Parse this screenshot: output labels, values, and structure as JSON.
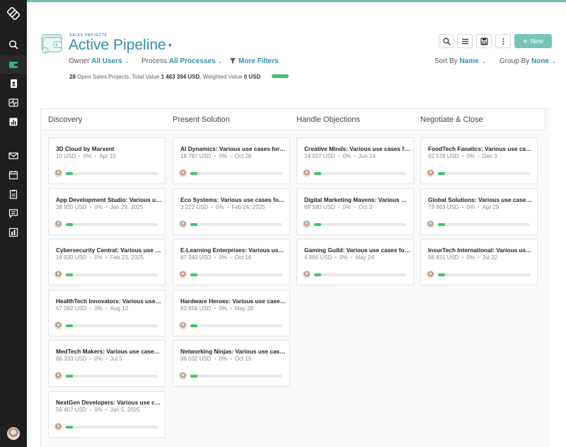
{
  "colors": {
    "accent": "#2f8fb0",
    "new_button": "#76c4b6",
    "progress": "#3cc46a",
    "sidebar": "#1f1f1f"
  },
  "sidebar": {
    "logo": "layers-logo-icon",
    "items": [
      {
        "icon": "search-icon"
      },
      {
        "icon": "wallet-icon",
        "active": true
      },
      {
        "icon": "contacts-icon"
      },
      {
        "icon": "activity-icon"
      },
      {
        "icon": "report-icon"
      },
      {
        "icon": "mail-icon"
      },
      {
        "icon": "calendar-icon"
      },
      {
        "icon": "clipboard-icon"
      },
      {
        "icon": "chat-icon"
      },
      {
        "icon": "chart-icon"
      }
    ]
  },
  "header": {
    "subtitle": "SALES PROJECTS",
    "title": "Active Pipeline",
    "owner_label": "Owner",
    "owner_value": "All Users",
    "process_label": "Process",
    "process_value": "All Processes",
    "more_filters": "More Filters",
    "summary": {
      "count": "28",
      "text1": "Open Sales Projects, Total Value",
      "total": "1 463 394 USD",
      "text2": ", Weighted Value",
      "weighted": "0 USD"
    }
  },
  "toolbar": {
    "new_label": "New",
    "sort_label": "Sort By",
    "sort_value": "Name",
    "group_label": "Group By",
    "group_value": "None"
  },
  "columns": [
    {
      "title": "Discovery",
      "cards": [
        {
          "name": "3D Cloud by Marxent",
          "value": "10 USD",
          "percent": "0%",
          "date": "Apr 10",
          "progress": 0.08
        },
        {
          "name": "App Development Studio: Various use cases for Plan",
          "value": "38 920 USD",
          "percent": "0%",
          "date": "Jan 29, 2025",
          "progress": 0.08
        },
        {
          "name": "Cybersecurity Central: Various use cases for Plan",
          "value": "16 930 USD",
          "percent": "0%",
          "date": "Feb 23, 2025",
          "progress": 0.08
        },
        {
          "name": "HealthTech Innovators: Various use cases for Plan",
          "value": "67 092 USD",
          "percent": "0%",
          "date": "Aug 12",
          "progress": 0.08
        },
        {
          "name": "MedTech Makers: Various use cases for Plan",
          "value": "66 333 USD",
          "percent": "0%",
          "date": "Jul 5",
          "progress": 0.08
        },
        {
          "name": "NextGen Developers: Various use cases for Plan",
          "value": "56 407 USD",
          "percent": "0%",
          "date": "Jan 5, 2025",
          "progress": 0.08
        }
      ]
    },
    {
      "title": "Present Solution",
      "cards": [
        {
          "name": "AI Dynamics: Various use cases for Plan",
          "value": "18 787 USD",
          "percent": "0%",
          "date": "Oct 26",
          "progress": 0.08
        },
        {
          "name": "Eco Systems: Various use cases for Plan",
          "value": "3 222 USD",
          "percent": "0%",
          "date": "Feb 24, 2025",
          "progress": 0.08
        },
        {
          "name": "E-Learning Enterprises: Various use cases for Plan",
          "value": "87 340 USD",
          "percent": "0%",
          "date": "Oct 16",
          "progress": 0.08
        },
        {
          "name": "Hardware Heroes: Various use cases for Plan",
          "value": "83 656 USD",
          "percent": "0%",
          "date": "May 28",
          "progress": 0.08
        },
        {
          "name": "Networking Ninjas: Various use cases for Plan",
          "value": "96 032 USD",
          "percent": "0%",
          "date": "Oct 15",
          "progress": 0.08
        }
      ]
    },
    {
      "title": "Handle Objections",
      "cards": [
        {
          "name": "Creative Minds: Various use cases for Plan",
          "value": "24 027 USD",
          "percent": "0%",
          "date": "Jun 14",
          "progress": 0.08
        },
        {
          "name": "Digital Marketing Mavens: Various use cases for Plan",
          "value": "69 580 USD",
          "percent": "0%",
          "date": "Oct 3",
          "progress": 0.08
        },
        {
          "name": "Gaming Guild: Various use cases for Plan",
          "value": "4 966 USD",
          "percent": "0%",
          "date": "May 24",
          "progress": 0.08
        }
      ]
    },
    {
      "title": "Negotiate & Close",
      "cards": [
        {
          "name": "FoodTech Fanatics: Various use cases for Plan",
          "value": "62 578 USD",
          "percent": "0%",
          "date": "Dec 3",
          "progress": 0.08
        },
        {
          "name": "Global Solutions: Various use cases for Plan",
          "value": "79 663 USD",
          "percent": "0%",
          "date": "Apr 29",
          "progress": 0.08
        },
        {
          "name": "InsurTech International: Various use cases for Plan",
          "value": "98 831 USD",
          "percent": "0%",
          "date": "Jul 22",
          "progress": 0.08
        }
      ]
    }
  ]
}
